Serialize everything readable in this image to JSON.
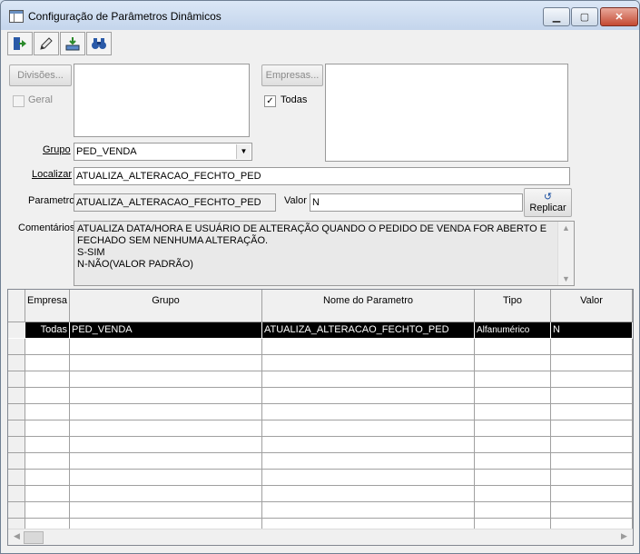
{
  "window": {
    "title": "Configuração de Parâmetros Dinâmicos"
  },
  "toolbar": {
    "icons": [
      "exit-icon",
      "edit-icon",
      "export-icon",
      "binoculars-icon"
    ]
  },
  "divisoes": {
    "button_label": "Divisões...",
    "geral_label": "Geral",
    "geral_checked": false
  },
  "empresas": {
    "button_label": "Empresas...",
    "todas_label": "Todas",
    "todas_checked": true,
    "check_mark": "✓"
  },
  "grupo": {
    "label": "Grupo",
    "value": "PED_VENDA"
  },
  "localizar": {
    "label": "Localizar",
    "value": "ATUALIZA_ALTERACAO_FECHTO_PED"
  },
  "parametro": {
    "label": "Parametro",
    "value": "ATUALIZA_ALTERACAO_FECHTO_PED"
  },
  "valor": {
    "label": "Valor",
    "value": "N"
  },
  "replicar": {
    "label": "Replicar"
  },
  "comentarios": {
    "label": "Comentários",
    "lines": [
      "ATUALIZA DATA/HORA E USUÁRIO DE ALTERAÇÃO QUANDO O PEDIDO DE VENDA FOR ABERTO E",
      "FECHADO SEM NENHUMA ALTERAÇÃO.",
      "S-SIM",
      "N-NÃO(VALOR PADRÃO)"
    ]
  },
  "grid": {
    "headers": [
      "Empresa",
      "Grupo",
      "Nome do Parametro",
      "Tipo",
      "Valor"
    ],
    "rows": [
      {
        "empresa": "Todas",
        "grupo": "PED_VENDA",
        "nome": "ATUALIZA_ALTERACAO_FECHTO_PED",
        "tipo": "Alfanumérico",
        "valor": "N"
      }
    ],
    "empty_rows": 12
  }
}
